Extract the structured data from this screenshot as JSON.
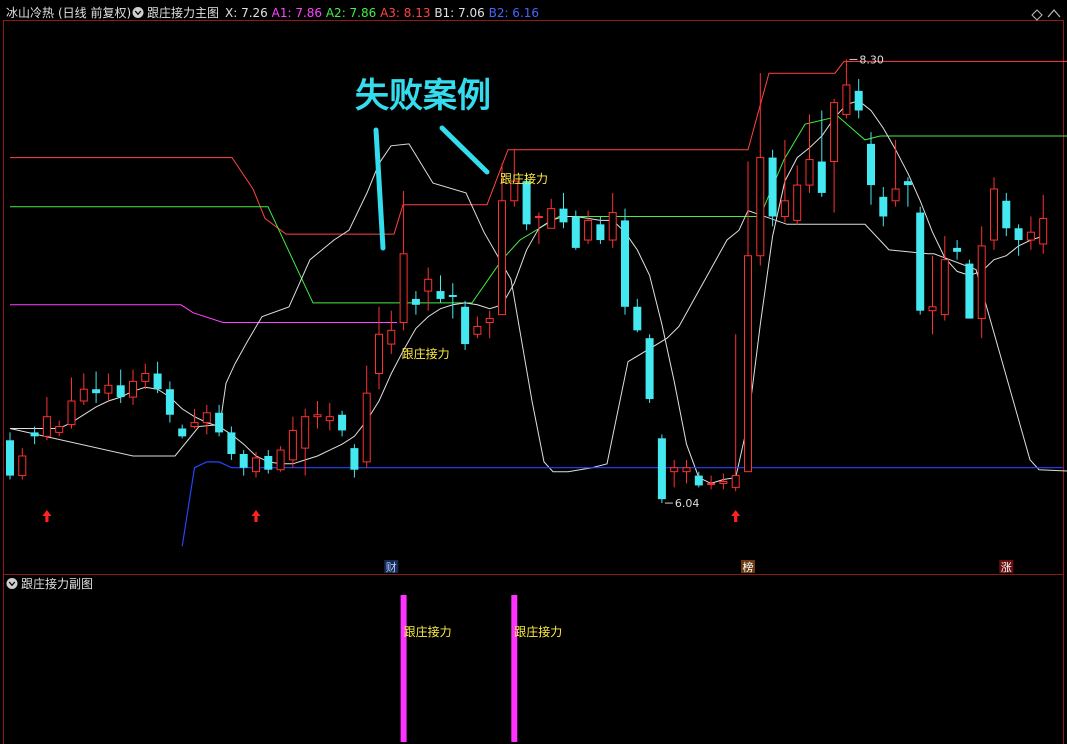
{
  "header": {
    "stock_name": "冰山冷热",
    "period": "(日线 前复权)",
    "indicator": "跟庄接力主图",
    "readouts": [
      {
        "label": "X: 7.26",
        "color": "#e0e0e0"
      },
      {
        "label": "A1: 7.86",
        "color": "#ff44ff"
      },
      {
        "label": "A2: 7.86",
        "color": "#44ee44"
      },
      {
        "label": "A3: 8.13",
        "color": "#ff4444"
      },
      {
        "label": "B1: 7.06",
        "color": "#e0e0e0"
      },
      {
        "label": "B2: 6.16",
        "color": "#4466ff"
      }
    ]
  },
  "annotation": {
    "title": "失败案例",
    "color": "#33ddee"
  },
  "sub_panel": {
    "title": "跟庄接力副图"
  },
  "chart_data": [
    {
      "type": "candlestick",
      "price_range": [
        5.75,
        8.45
      ],
      "colors": {
        "up": "#ff3030",
        "down": "#44e8f0",
        "A1": "#ff44ff",
        "A2": "#44ee44",
        "A3": "#ff4444",
        "B1": "#e0e0e0",
        "B2": "#2244ff",
        "signal_text": "#ffee44"
      },
      "candles": [
        [
          6.36,
          6.18,
          6.4,
          6.16
        ],
        [
          6.18,
          6.28,
          6.32,
          6.16
        ],
        [
          6.4,
          6.38,
          6.43,
          6.34
        ],
        [
          6.38,
          6.48,
          6.58,
          6.36
        ],
        [
          6.4,
          6.43,
          6.46,
          6.38
        ],
        [
          6.44,
          6.56,
          6.68,
          6.42
        ],
        [
          6.56,
          6.62,
          6.7,
          6.54
        ],
        [
          6.62,
          6.6,
          6.71,
          6.55
        ],
        [
          6.6,
          6.64,
          6.7,
          6.56
        ],
        [
          6.64,
          6.58,
          6.72,
          6.55
        ],
        [
          6.58,
          6.66,
          6.72,
          6.54
        ],
        [
          6.66,
          6.7,
          6.75,
          6.62
        ],
        [
          6.7,
          6.62,
          6.76,
          6.6
        ],
        [
          6.62,
          6.49,
          6.66,
          6.45
        ],
        [
          6.42,
          6.38,
          6.44,
          6.37
        ],
        [
          6.43,
          6.45,
          6.52,
          6.42
        ],
        [
          6.45,
          6.5,
          6.54,
          6.39
        ],
        [
          6.5,
          6.4,
          6.54,
          6.38
        ],
        [
          6.4,
          6.29,
          6.43,
          6.26
        ],
        [
          6.29,
          6.22,
          6.31,
          6.18
        ],
        [
          6.2,
          6.27,
          6.3,
          6.17
        ],
        [
          6.28,
          6.21,
          6.31,
          6.19
        ],
        [
          6.21,
          6.31,
          6.33,
          6.2
        ],
        [
          6.26,
          6.41,
          6.48,
          6.22
        ],
        [
          6.32,
          6.48,
          6.52,
          6.18
        ],
        [
          6.48,
          6.49,
          6.56,
          6.42
        ],
        [
          6.46,
          6.48,
          6.55,
          6.41
        ],
        [
          6.49,
          6.41,
          6.51,
          6.38
        ],
        [
          6.32,
          6.21,
          6.34,
          6.17
        ],
        [
          6.25,
          6.6,
          6.74,
          6.22
        ],
        [
          6.7,
          6.9,
          7.04,
          6.62
        ],
        [
          6.85,
          6.92,
          7.02,
          6.8
        ],
        [
          6.96,
          7.31,
          7.63,
          6.92
        ],
        [
          7.08,
          7.05,
          7.12,
          7.0
        ],
        [
          7.12,
          7.18,
          7.24,
          7.02
        ],
        [
          7.12,
          7.08,
          7.2,
          7.06
        ],
        [
          7.1,
          7.09,
          7.16,
          6.98
        ],
        [
          7.04,
          6.85,
          7.07,
          6.82
        ],
        [
          6.9,
          6.94,
          6.99,
          6.88
        ],
        [
          6.96,
          6.98,
          7.02,
          6.88
        ],
        [
          7.0,
          7.58,
          7.77,
          7.0
        ],
        [
          7.58,
          7.68,
          7.84,
          7.55
        ],
        [
          7.68,
          7.46,
          7.72,
          7.43
        ],
        [
          7.5,
          7.5,
          7.52,
          7.36
        ],
        [
          7.44,
          7.54,
          7.59,
          7.44
        ],
        [
          7.54,
          7.47,
          7.62,
          7.44
        ],
        [
          7.5,
          7.34,
          7.53,
          7.33
        ],
        [
          7.38,
          7.48,
          7.53,
          7.36
        ],
        [
          7.46,
          7.38,
          7.5,
          7.36
        ],
        [
          7.38,
          7.52,
          7.62,
          7.34
        ],
        [
          7.48,
          7.04,
          7.54,
          7.0
        ],
        [
          7.04,
          6.92,
          7.08,
          6.91
        ],
        [
          6.88,
          6.57,
          6.9,
          6.55
        ],
        [
          6.37,
          6.06,
          6.39,
          6.04
        ],
        [
          6.2,
          6.22,
          6.26,
          6.12
        ],
        [
          6.2,
          6.22,
          6.26,
          6.14
        ],
        [
          6.18,
          6.13,
          6.2,
          6.12
        ],
        [
          6.14,
          6.14,
          6.18,
          6.11
        ],
        [
          6.14,
          6.15,
          6.19,
          6.11
        ],
        [
          6.12,
          6.18,
          6.9,
          6.1
        ],
        [
          6.2,
          7.3,
          7.78,
          6.2
        ],
        [
          7.3,
          7.8,
          8.23,
          7.25
        ],
        [
          7.8,
          7.5,
          7.84,
          7.45
        ],
        [
          7.5,
          7.58,
          7.89,
          7.47
        ],
        [
          7.48,
          7.66,
          7.76,
          7.46
        ],
        [
          7.66,
          7.79,
          8.02,
          7.62
        ],
        [
          7.78,
          7.62,
          8.04,
          7.6
        ],
        [
          7.78,
          8.08,
          8.1,
          7.52
        ],
        [
          8.02,
          8.17,
          8.3,
          8.0
        ],
        [
          8.14,
          8.04,
          8.2,
          8.0
        ],
        [
          7.87,
          7.66,
          7.93,
          7.56
        ],
        [
          7.6,
          7.5,
          7.65,
          7.45
        ],
        [
          7.58,
          7.64,
          7.89,
          7.55
        ],
        [
          7.68,
          7.66,
          7.7,
          7.55
        ],
        [
          7.52,
          7.02,
          7.55,
          7.0
        ],
        [
          7.02,
          7.04,
          7.3,
          6.9
        ],
        [
          7.0,
          7.28,
          7.4,
          6.97
        ],
        [
          7.34,
          7.32,
          7.38,
          7.28
        ],
        [
          7.26,
          6.98,
          7.28,
          6.98
        ],
        [
          6.98,
          7.35,
          7.45,
          6.88
        ],
        [
          7.38,
          7.64,
          7.7,
          7.33
        ],
        [
          7.58,
          7.44,
          7.62,
          7.4
        ],
        [
          7.44,
          7.38,
          7.46,
          7.3
        ],
        [
          7.38,
          7.42,
          7.5,
          7.33
        ],
        [
          7.36,
          7.49,
          7.61,
          7.31
        ]
      ],
      "B1": [
        6.42,
        6.42,
        6.42,
        6.42,
        6.42,
        6.45,
        6.49,
        6.53,
        6.56,
        6.58,
        6.61,
        6.63,
        6.62,
        6.58,
        6.52,
        6.48,
        6.45,
        6.43,
        6.39,
        6.34,
        6.28,
        6.25,
        6.24,
        6.24,
        6.26,
        6.28,
        6.31,
        6.34,
        6.38,
        6.46,
        6.56,
        6.7,
        6.82,
        6.93,
        6.99,
        7.03,
        7.05,
        7.06,
        7.05,
        7.03,
        7.05,
        7.16,
        7.33,
        7.44,
        7.48,
        7.5,
        7.5,
        7.49,
        7.48,
        7.48,
        7.42,
        7.33,
        7.2,
        6.95,
        6.66,
        6.34,
        6.17,
        6.14,
        6.16,
        6.17,
        6.45,
        6.95,
        7.4,
        7.68,
        7.8,
        7.85,
        7.91,
        8.0,
        8.07,
        8.09,
        8.04,
        7.95,
        7.84,
        7.72,
        7.58,
        7.42,
        7.29,
        7.22,
        7.2,
        7.22,
        7.28,
        7.3,
        7.35,
        7.38,
        7.4
      ],
      "B2": [
        null,
        null,
        null,
        null,
        null,
        null,
        null,
        null,
        null,
        null,
        null,
        null,
        null,
        null,
        5.82,
        6.22,
        6.25,
        6.25,
        6.22,
        6.22,
        6.22,
        6.22,
        6.22,
        6.22,
        6.22,
        6.22,
        6.22,
        6.22,
        6.22,
        6.22,
        6.22,
        6.22,
        6.22,
        6.22,
        6.22,
        6.22,
        6.22,
        6.22,
        6.22,
        6.22,
        6.22,
        6.22,
        6.22,
        6.22,
        6.22,
        6.22,
        6.22,
        6.22,
        6.22,
        6.22,
        6.22,
        6.22,
        6.22,
        6.22,
        6.22,
        6.22,
        6.22,
        6.22,
        6.22,
        6.22,
        6.22,
        6.22,
        6.22,
        6.22,
        6.22,
        6.22,
        6.22,
        6.22,
        6.22,
        6.22,
        6.22,
        6.22,
        6.22,
        6.22,
        6.22,
        6.22,
        6.22,
        6.22,
        6.22,
        6.22,
        6.22,
        6.22,
        6.22,
        6.22,
        6.22
      ],
      "white_band": [
        [
          0,
          6.42
        ],
        [
          41,
          6.28
        ],
        [
          55,
          6.28
        ],
        [
          63,
          6.43
        ],
        [
          70,
          6.44
        ],
        [
          72,
          6.65
        ],
        [
          75,
          6.75
        ],
        [
          79,
          6.86
        ],
        [
          84,
          6.99
        ],
        [
          93,
          7.04
        ],
        [
          100,
          7.28
        ],
        [
          108,
          7.38
        ],
        [
          113,
          7.43
        ],
        [
          119,
          7.62
        ],
        [
          123,
          7.77
        ],
        [
          127,
          7.86
        ],
        [
          133,
          7.87
        ],
        [
          141,
          7.67
        ],
        [
          152,
          7.62
        ],
        [
          158,
          7.42
        ],
        [
          167,
          7.18
        ],
        [
          174,
          6.56
        ],
        [
          178,
          6.25
        ],
        [
          181,
          6.2
        ],
        [
          186,
          6.2
        ],
        [
          194,
          6.22
        ],
        [
          199,
          6.24
        ],
        [
          206,
          6.76
        ],
        [
          219,
          6.88
        ],
        [
          223,
          6.94
        ],
        [
          239,
          7.38
        ],
        [
          243,
          7.43
        ],
        [
          246,
          7.53
        ],
        [
          259,
          7.46
        ],
        [
          285,
          7.46
        ],
        [
          293,
          7.33
        ],
        [
          306,
          7.31
        ],
        [
          308,
          7.31
        ],
        [
          322,
          7.23
        ],
        [
          340,
          6.26
        ],
        [
          343,
          6.21
        ],
        [
          357,
          6.2
        ]
      ],
      "A1_line": [
        [
          0,
          7.05
        ],
        [
          57,
          7.05
        ],
        [
          61,
          7.01
        ],
        [
          71,
          6.96
        ],
        [
          129,
          6.96
        ]
      ],
      "A2_line": [
        [
          0,
          7.55
        ],
        [
          86,
          7.55
        ],
        [
          101,
          7.06
        ],
        [
          154,
          7.06
        ],
        [
          164,
          7.28
        ],
        [
          170,
          7.38
        ],
        [
          183,
          7.5
        ],
        [
          250,
          7.5
        ],
        [
          258,
          7.79
        ],
        [
          265,
          7.97
        ],
        [
          276,
          8.01
        ],
        [
          285,
          7.89
        ],
        [
          290,
          7.91
        ],
        [
          356,
          7.91
        ]
      ],
      "A3_line": [
        [
          0,
          7.8
        ],
        [
          74,
          7.8
        ],
        [
          81,
          7.64
        ],
        [
          85,
          7.49
        ],
        [
          92,
          7.41
        ],
        [
          128,
          7.41
        ],
        [
          131,
          7.56
        ],
        [
          159,
          7.56
        ],
        [
          166,
          7.84
        ],
        [
          246,
          7.84
        ],
        [
          253,
          8.23
        ],
        [
          275,
          8.23
        ],
        [
          278,
          8.29
        ],
        [
          356,
          8.29
        ]
      ],
      "signal_labels": [
        {
          "text": "跟庄接力",
          "candle": 32,
          "price": 6.78
        },
        {
          "text": "跟庄接力",
          "candle": 40,
          "price": 7.67
        }
      ],
      "up_arrows": [
        3,
        20,
        59
      ],
      "price_labels": [
        {
          "text": "8.30",
          "candle": 68,
          "price": 8.3
        },
        {
          "text": "6.04",
          "candle": 53,
          "price": 6.04
        }
      ],
      "event_markers": [
        {
          "text": "财",
          "candle": 31,
          "bg": "#1a2a55",
          "fg": "#aaccff"
        },
        {
          "text": "榜",
          "candle": 60,
          "bg": "#6b3a10",
          "fg": "#ffffff"
        },
        {
          "text": "涨",
          "candle": 81,
          "bg": "#6b1010",
          "fg": "#ffffff"
        }
      ]
    },
    {
      "type": "bar",
      "title": "跟庄接力副图",
      "signals": [
        {
          "candle": 32,
          "label": "跟庄接力"
        },
        {
          "candle": 41,
          "label": "跟庄接力"
        }
      ],
      "bar_color": "#ff33ff"
    }
  ]
}
